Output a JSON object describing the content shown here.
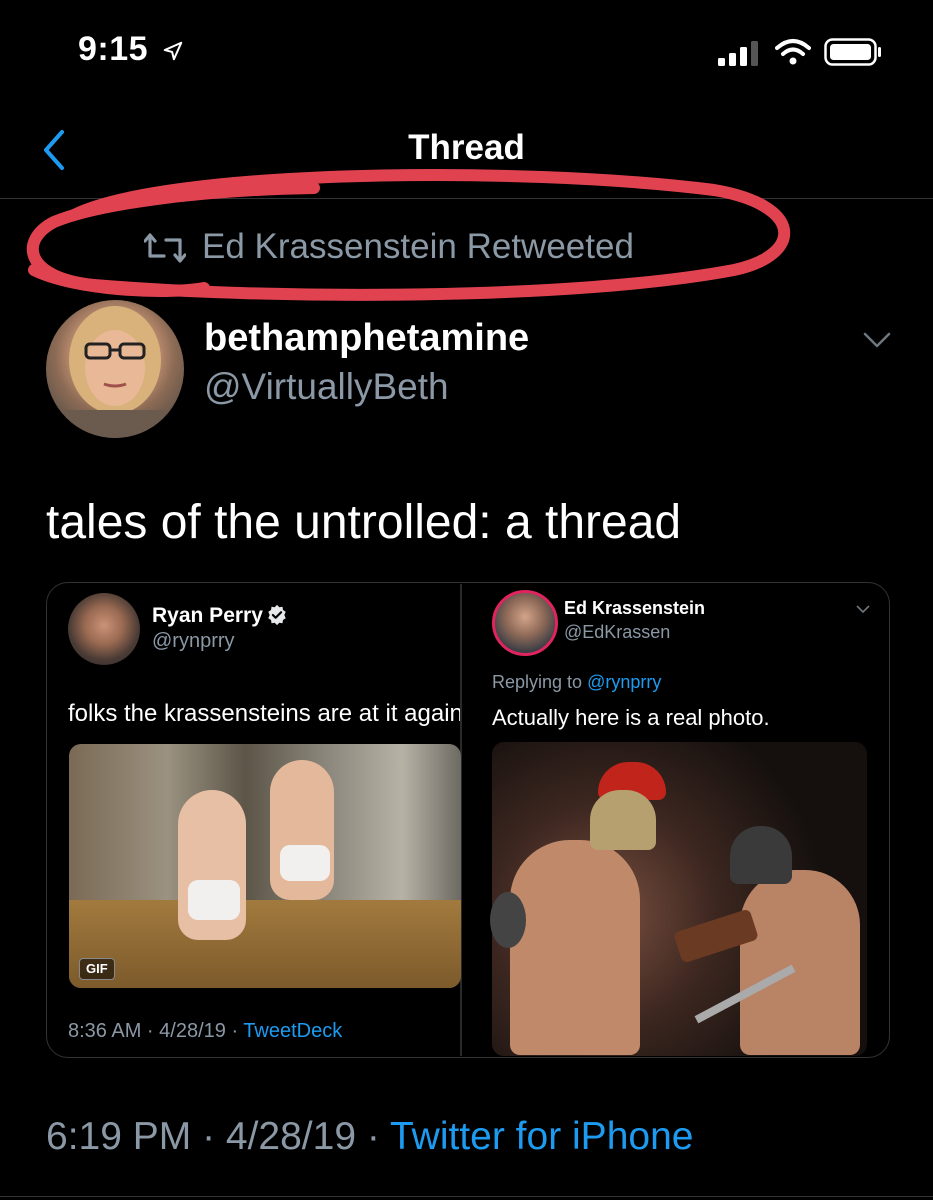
{
  "status_bar": {
    "time": "9:15"
  },
  "nav": {
    "title": "Thread"
  },
  "retweet": {
    "text": "Ed Krassenstein Retweeted"
  },
  "author": {
    "name": "bethamphetamine",
    "handle": "@VirtuallyBeth"
  },
  "tweet": {
    "text": "tales of the untrolled: a thread",
    "timestamp": "6:19 PM · 4/28/19 · ",
    "source": "Twitter for iPhone"
  },
  "embedded": {
    "left": {
      "name": "Ryan Perry",
      "handle": "@rynprry",
      "text": "folks the krassensteins are at it again",
      "gif_badge": "GIF",
      "meta": "8:36 AM · 4/28/19 · ",
      "app": "TweetDeck"
    },
    "right": {
      "name": "Ed Krassenstein",
      "handle": "@EdKrassen",
      "reply_prefix": "Replying to ",
      "reply_to": "@rynprry",
      "text": "Actually here is a real photo."
    }
  },
  "colors": {
    "accent": "#1d9bf0",
    "annotation": "#e0434f",
    "muted": "#8b98a5"
  },
  "icons": [
    "location-arrow-icon",
    "signal-icon",
    "wifi-icon",
    "battery-icon",
    "back-chevron-icon",
    "retweet-icon",
    "chevron-down-icon",
    "verified-icon"
  ]
}
